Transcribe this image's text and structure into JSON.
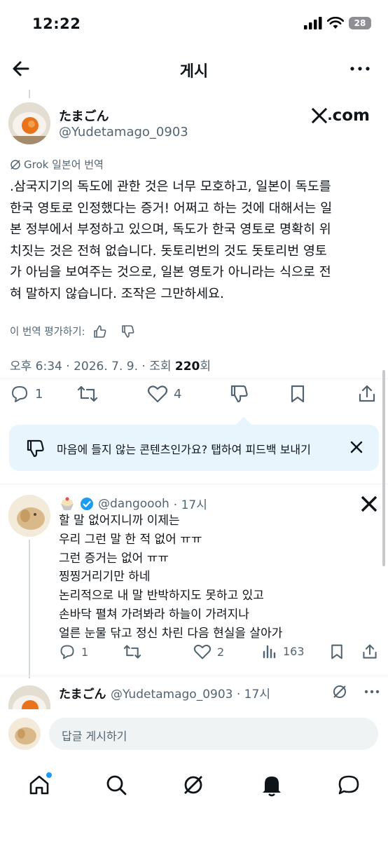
{
  "status_bar": {
    "time": "12:22",
    "battery": "28"
  },
  "header": {
    "title": "게시"
  },
  "post": {
    "author_name": "たまごん",
    "author_handle": "@Yudetamago_0903",
    "source_logo": "com",
    "translation_label": "Grok 일본어 번역",
    "body_lines": [
      ".삼국지기의 독도에 관한 것은 너무 모호하고, 일본이 독도를",
      "한국 영토로 인정했다는 증거! 어쩌고 하는 것에 대해서는 일",
      "본 정부에서 부정하고 있으며, 독도가 한국 영토로 명확히 위",
      "치짓는 것은 전혀 없습니다. 돗토리번의 것도 돗토리번 영토",
      "가 아님을 보여주는 것으로, 일본 영토가 아니라는 식으로 전",
      "혀 말하지 않습니다. 조작은 그만하세요."
    ],
    "rate_label": "이 번역 평가하기:",
    "timestamp": "오후 6:34 · 2026. 7. 9. · 조회 ",
    "views": "220",
    "views_suffix": "회",
    "replies": "1",
    "likes": "4"
  },
  "feedback": {
    "text": "마음에 들지 않는 콘텐츠인가요? 탭하여 피드백 보내기"
  },
  "reply": {
    "handle": "@dangoooh",
    "time": "· 17시",
    "lines": [
      "할 말 없어지니까 이제는",
      "우리 그런 말 한 적 없어 ㅠㅠ",
      "그런 증거는 없어 ㅠㅠ",
      "찡찡거리기만 하네",
      "논리적으로 내 말 반박하지도 못하고 있고",
      "손바닥 펼쳐 가려봐라 하늘이 가려지나",
      "얼른 눈물 닦고 정신 차린 다음 현실을 살아가"
    ],
    "replies": "1",
    "likes": "2",
    "views": "163"
  },
  "next_reply": {
    "name": "たまごん",
    "handle_time": "@Yudetamago_0903 · 17시"
  },
  "compose": {
    "placeholder": "답글 게시하기"
  },
  "colors": {
    "accent": "#1d9bf0",
    "secondary_text": "#536471",
    "banner_bg": "#e8f5fd"
  }
}
